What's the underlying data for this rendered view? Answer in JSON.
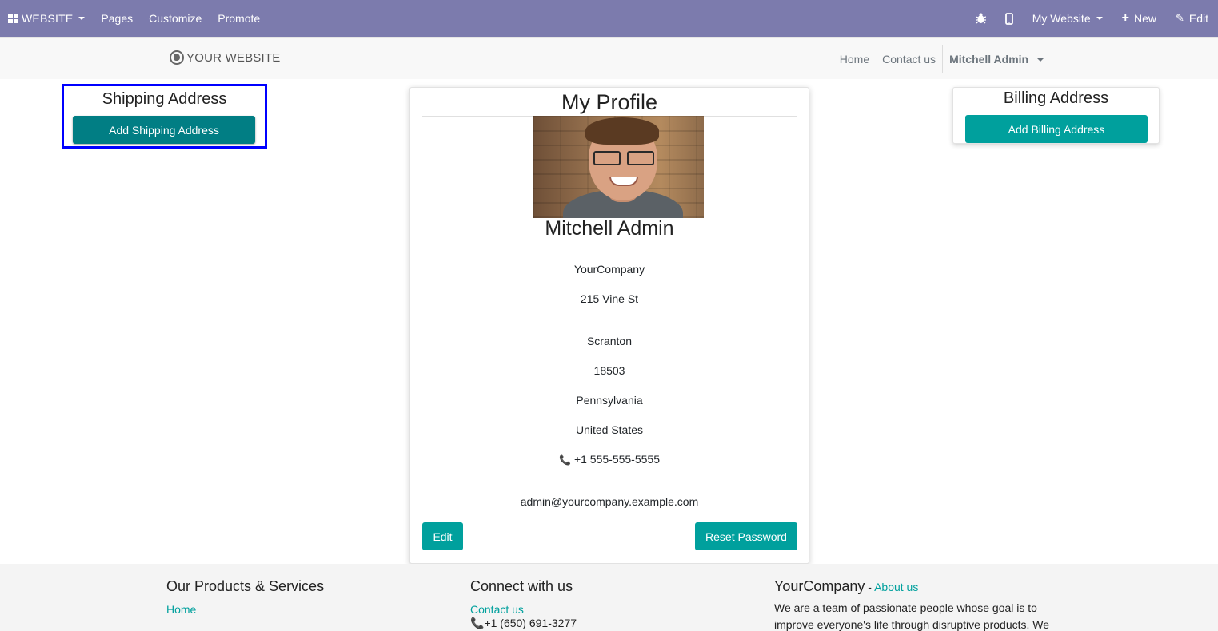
{
  "adminbar": {
    "apps_label": "WEBSITE",
    "menu": [
      "Pages",
      "Customize",
      "Promote"
    ],
    "website_selector": "My Website",
    "new_label": "New",
    "edit_label": "Edit"
  },
  "header": {
    "logo_text": "YOUR WEBSITE",
    "nav": [
      "Home",
      "Contact us"
    ],
    "user": "Mitchell Admin"
  },
  "shipping": {
    "title": "Shipping Address",
    "button": "Add Shipping Address"
  },
  "billing": {
    "title": "Billing Address",
    "button": "Add Billing Address"
  },
  "profile": {
    "title": "My Profile",
    "name": "Mitchell Admin",
    "company": "YourCompany",
    "street": "215 Vine St",
    "city": "Scranton",
    "zip": "18503",
    "state": "Pennsylvania",
    "country": "United States",
    "phone": "+1 555-555-5555",
    "email": "admin@yourcompany.example.com",
    "edit_button": "Edit",
    "reset_button": "Reset Password"
  },
  "footer": {
    "col1": {
      "title": "Our Products & Services",
      "link": "Home"
    },
    "col2": {
      "title": "Connect with us",
      "link": "Contact us",
      "phone": "+1 (650) 691-3277"
    },
    "col3": {
      "title": "YourCompany",
      "about": "About us",
      "separator": " - ",
      "text": "We are a team of passionate people whose goal is to improve everyone's life through disruptive products. We"
    }
  },
  "colors": {
    "adminbar": "#7c7bad",
    "primary": "#00a09d",
    "primary_dark": "#017e84",
    "highlight": "#0000ff"
  }
}
